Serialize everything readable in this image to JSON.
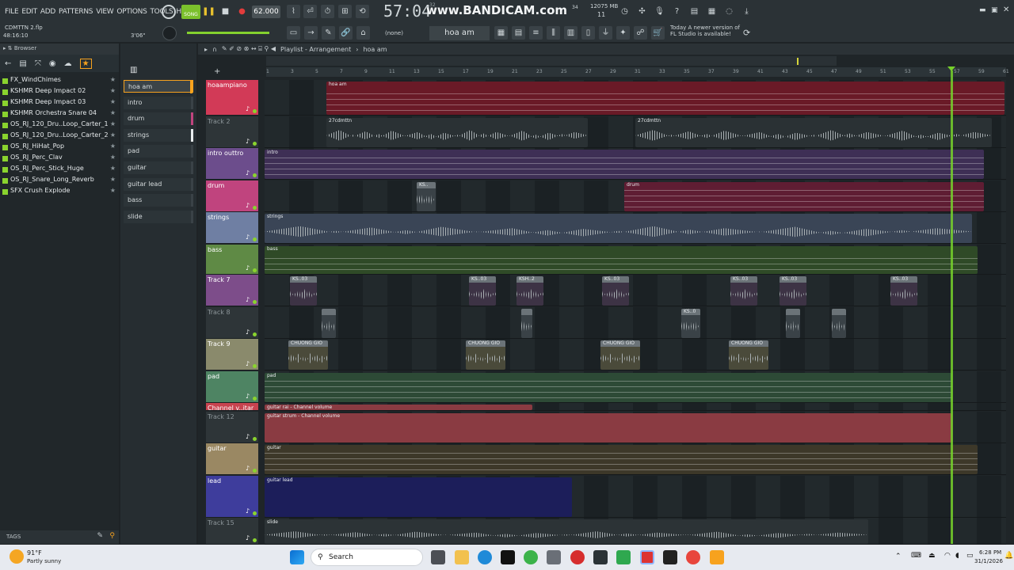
{
  "menu": [
    "FILE",
    "EDIT",
    "ADD",
    "PATTERNS",
    "VIEW",
    "OPTIONS",
    "TOOLS",
    "HELP"
  ],
  "toolbar": {
    "song_mode": "SONG",
    "tempo": "62.000",
    "time": "57:04",
    "time_sub": "32",
    "watermark": "www.BANDICAM.com",
    "memory": "12075 MB",
    "memory_sub": "11",
    "cpu": "34"
  },
  "project": {
    "file": "CDMTTN 2.flp",
    "elapsed": "48:16:10",
    "hint": "3'06\""
  },
  "row2": {
    "pattern_none": "(none)",
    "pattern_current": "hoa am",
    "news_today": "Today",
    "news_text1": "A newer version of",
    "news_text2": "FL Studio is available!"
  },
  "browser": {
    "title": "Browser",
    "items": [
      "FX_WindChimes",
      "KSHMR Deep Impact 02",
      "KSHMR Deep Impact 03",
      "KSHMR Orchestra Snare 04",
      "OS_RJ_120_Dru..Loop_Carter_1",
      "OS_RJ_120_Dru..Loop_Carter_2",
      "OS_RJ_HiHat_Pop",
      "OS_RJ_Perc_Clav",
      "OS_RJ_Perc_Stick_Huge",
      "OS_RJ_Snare_Long_Reverb",
      "SFX Crush Explode"
    ],
    "tags": "TAGS"
  },
  "chanrack": {
    "items": [
      "hoa am",
      "intro",
      "drum",
      "strings",
      "pad",
      "guitar",
      "guitar lead",
      "bass",
      "slide"
    ]
  },
  "playlist": {
    "title": "Playlist - Arrangement",
    "pattern": "hoa am",
    "ruler": [
      "1",
      "3",
      "5",
      "7",
      "9",
      "11",
      "13",
      "15",
      "17",
      "19",
      "21",
      "23",
      "25",
      "27",
      "29",
      "31",
      "33",
      "35",
      "37",
      "39",
      "41",
      "43",
      "45",
      "47",
      "49",
      "51",
      "53",
      "55",
      "57",
      "59",
      "61"
    ]
  },
  "tracks": [
    {
      "name": "hoaampiano",
      "color": "#d23a57",
      "h": 45,
      "clips": [
        {
          "t": "hoa am",
          "l": 78,
          "w": 856,
          "bg": "#6a1a27",
          "k": "notes"
        }
      ]
    },
    {
      "name": "Track 2",
      "color": "#2e3538",
      "h": 40,
      "clips": [
        {
          "t": "27cdmttn",
          "l": 78,
          "w": 330,
          "bg": "#2a3134",
          "k": "wave"
        },
        {
          "t": "27cdmttn",
          "l": 468,
          "w": 450,
          "bg": "#2a3134",
          "k": "wave"
        }
      ]
    },
    {
      "name": "intro outtro",
      "color": "#6c4d8c",
      "h": 40,
      "clips": [
        {
          "t": "intro",
          "l": 0,
          "w": 908,
          "bg": "#3e2f55",
          "k": "notes"
        }
      ]
    },
    {
      "name": "drum",
      "color": "#c0447e",
      "h": 40,
      "clips": [
        {
          "t": "KS..",
          "l": 192,
          "w": 24,
          "bg": "#3a4247",
          "k": "sm"
        },
        {
          "t": "drum",
          "l": 454,
          "w": 454,
          "bg": "#5f1d33",
          "k": "notes"
        }
      ]
    },
    {
      "name": "strings",
      "color": "#6f7fa3",
      "h": 40,
      "clips": [
        {
          "t": "strings",
          "l": 0,
          "w": 893,
          "bg": "#3a4556",
          "k": "wave"
        }
      ]
    },
    {
      "name": "bass",
      "color": "#5f8a45",
      "h": 38,
      "clips": [
        {
          "t": "bass",
          "l": 0,
          "w": 900,
          "bg": "#2f4a27",
          "k": "notes"
        }
      ]
    },
    {
      "name": "Track 7",
      "color": "#7d4d8a",
      "h": 40,
      "clips": [
        {
          "t": "KS..03",
          "l": 32,
          "w": 34,
          "bg": "#3d3345",
          "k": "sm"
        },
        {
          "t": "KS..03",
          "l": 258,
          "w": 34,
          "bg": "#3d3345",
          "k": "sm"
        },
        {
          "t": "KSH..2",
          "l": 318,
          "w": 34,
          "bg": "#3d3345",
          "k": "sm"
        },
        {
          "t": "KS..03",
          "l": 426,
          "w": 34,
          "bg": "#3d3345",
          "k": "sm"
        },
        {
          "t": "KS..03",
          "l": 588,
          "w": 34,
          "bg": "#3d3345",
          "k": "sm"
        },
        {
          "t": "KS..03",
          "l": 650,
          "w": 34,
          "bg": "#3d3345",
          "k": "sm"
        },
        {
          "t": "KS..03",
          "l": 790,
          "w": 34,
          "bg": "#3d3345",
          "k": "sm"
        }
      ]
    },
    {
      "name": "Track 8",
      "color": "#2e3538",
      "h": 40,
      "clips": [
        {
          "t": "",
          "l": 72,
          "w": 18,
          "bg": "#3a4247",
          "k": "sm"
        },
        {
          "t": "",
          "l": 324,
          "w": 14,
          "bg": "#3a4247",
          "k": "sm"
        },
        {
          "t": "KS..0",
          "l": 526,
          "w": 24,
          "bg": "#3a4247",
          "k": "sm"
        },
        {
          "t": "",
          "l": 658,
          "w": 18,
          "bg": "#3a4247",
          "k": "sm"
        },
        {
          "t": "",
          "l": 716,
          "w": 18,
          "bg": "#3a4247",
          "k": "sm"
        }
      ]
    },
    {
      "name": "Track 9",
      "color": "#8a8a6c",
      "h": 40,
      "clips": [
        {
          "t": "CHUONG GIO",
          "l": 30,
          "w": 50,
          "bg": "#4a4a3a",
          "k": "sm"
        },
        {
          "t": "CHUONG GIO",
          "l": 254,
          "w": 50,
          "bg": "#4a4a3a",
          "k": "sm"
        },
        {
          "t": "CHUONG GIO",
          "l": 424,
          "w": 50,
          "bg": "#4a4a3a",
          "k": "sm"
        },
        {
          "t": "CHUONG GIO",
          "l": 586,
          "w": 50,
          "bg": "#4a4a3a",
          "k": "sm"
        }
      ]
    },
    {
      "name": "pad",
      "color": "#4e8463",
      "h": 40,
      "clips": [
        {
          "t": "pad",
          "l": 0,
          "w": 868,
          "bg": "#2d4a36",
          "k": "notes"
        }
      ]
    },
    {
      "name": "Channel v..itar rai",
      "color": "#c8434f",
      "h": 10,
      "clips": [
        {
          "t": "guitar rai - Channel volume",
          "l": 0,
          "w": 338,
          "bg": "#8a3b42",
          "k": "flat"
        }
      ]
    },
    {
      "name": "Track 12",
      "color": "#2e3538",
      "h": 40,
      "clips": [
        {
          "t": "guitar strum - Channel volume",
          "l": 0,
          "w": 868,
          "bg": "#8a3b42",
          "k": "flat"
        }
      ]
    },
    {
      "name": "guitar",
      "color": "#9a8863",
      "h": 40,
      "clips": [
        {
          "t": "guitar",
          "l": 0,
          "w": 900,
          "bg": "#3d3829",
          "k": "notes"
        }
      ]
    },
    {
      "name": "lead",
      "color": "#3e3d9c",
      "h": 53,
      "clips": [
        {
          "t": "guitar lead",
          "l": 0,
          "w": 388,
          "bg": "#1c1e5a",
          "k": "flat"
        }
      ]
    },
    {
      "name": "Track 15",
      "color": "#2e3538",
      "h": 34,
      "clips": [
        {
          "t": "slide",
          "l": 0,
          "w": 762,
          "bg": "#2c3336",
          "k": "wave"
        }
      ]
    }
  ],
  "taskbar": {
    "weather_temp": "91°F",
    "weather_text": "Partly sunny",
    "search": "Search",
    "time": "6:28 PM",
    "date": "31/1/2026"
  },
  "colors": {
    "playhead": "#76d12b",
    "accent": "#f7a21e"
  }
}
